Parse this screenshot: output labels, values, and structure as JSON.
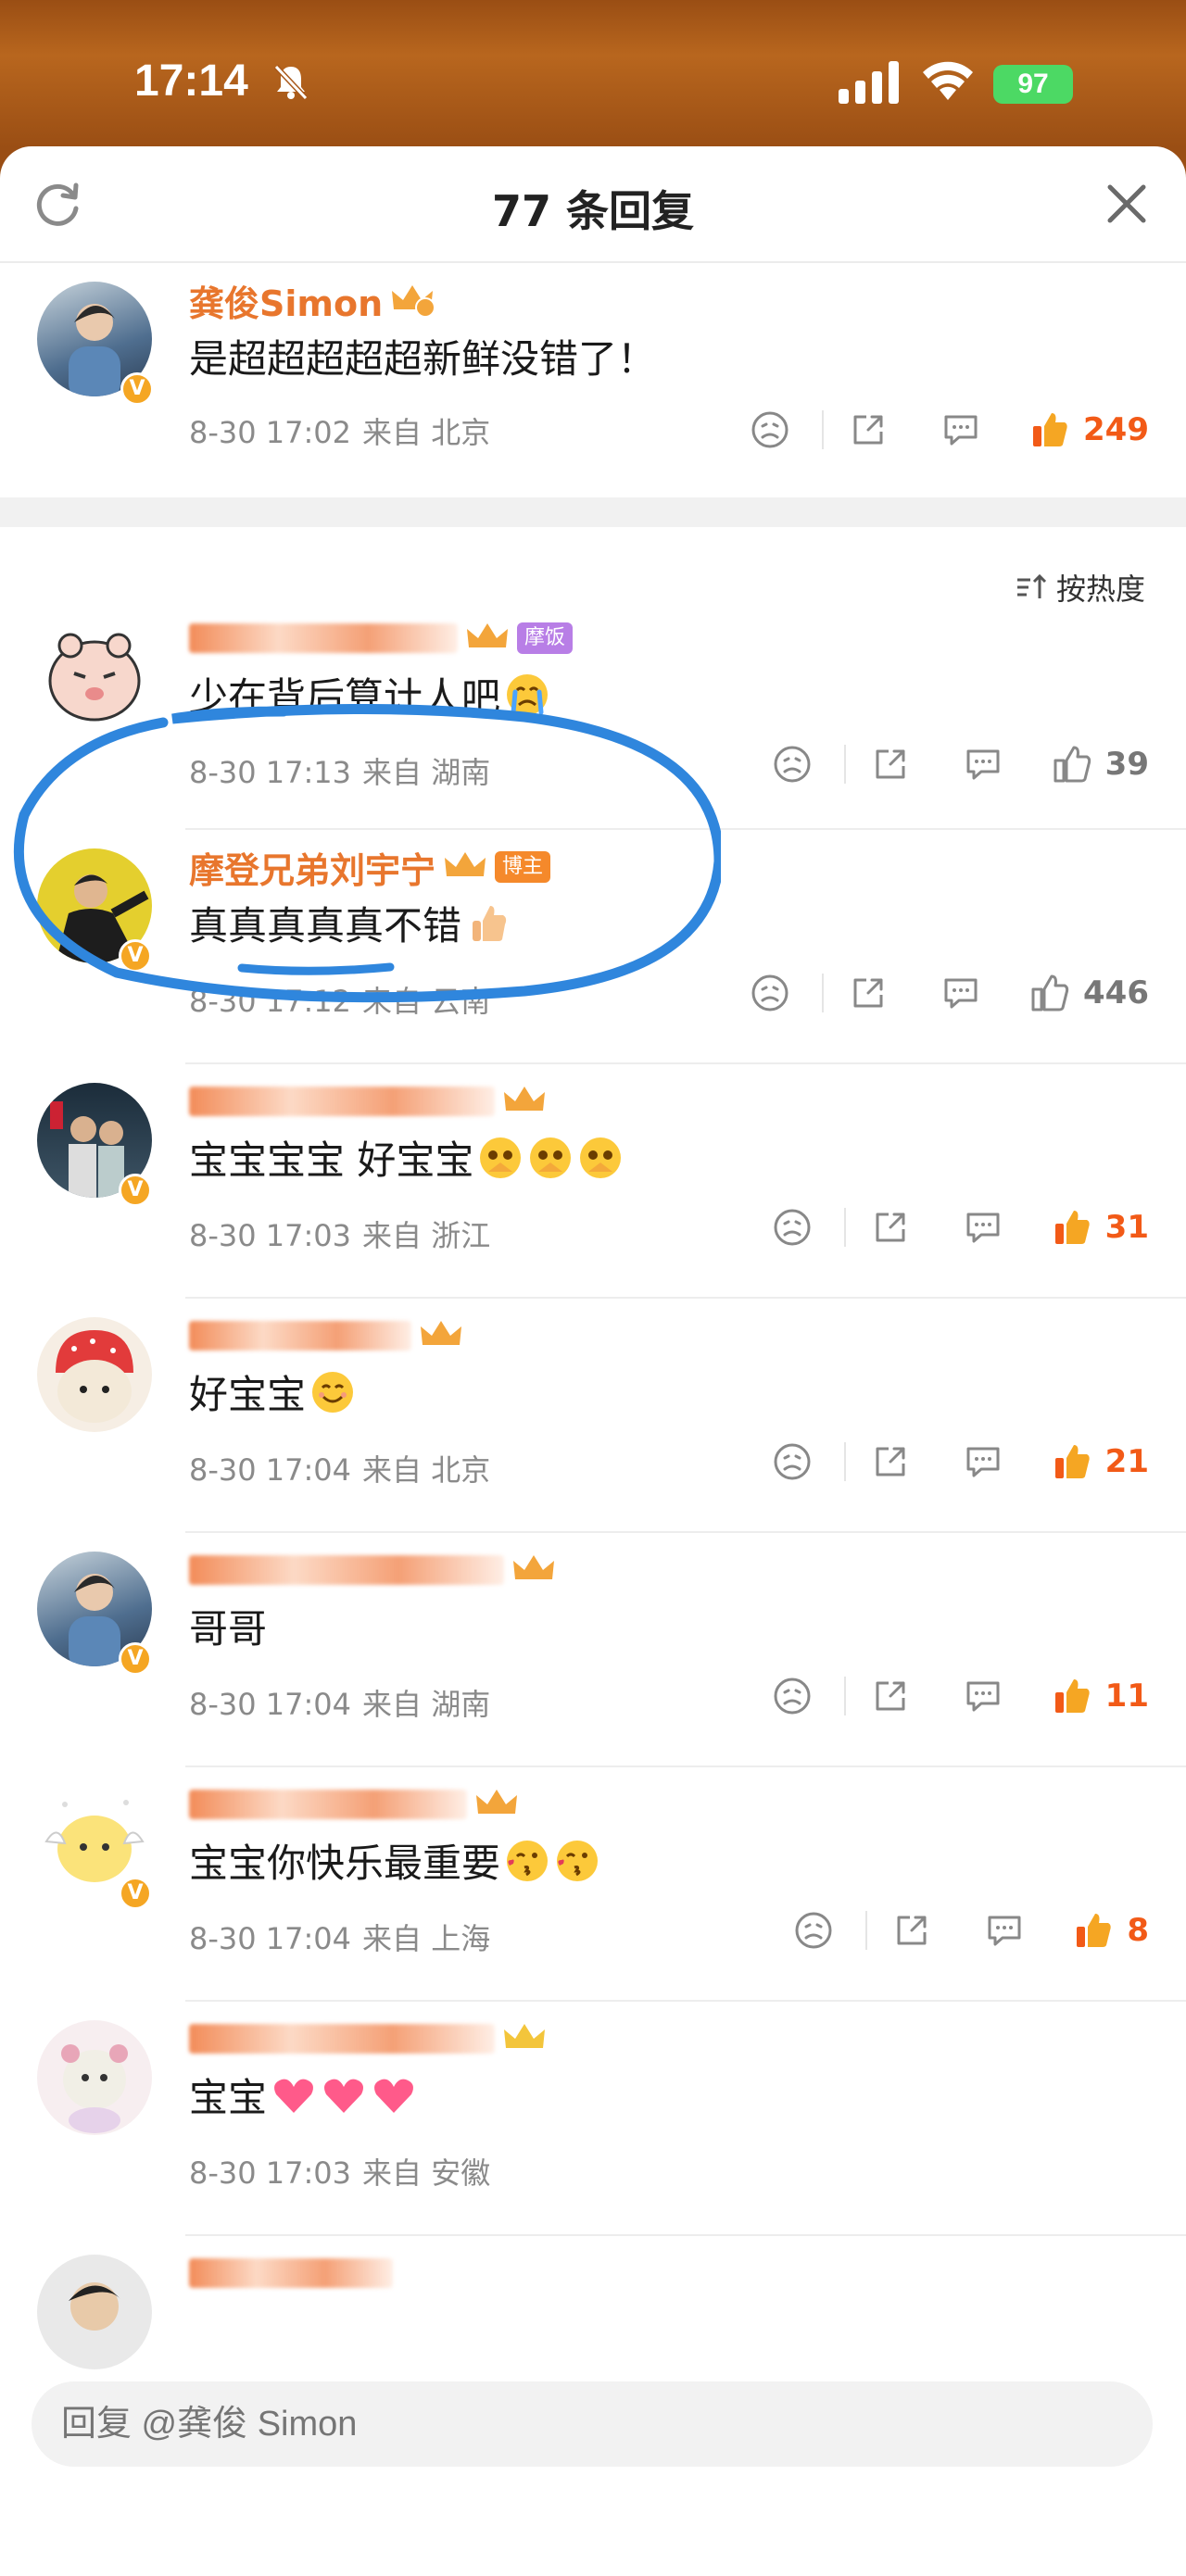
{
  "status_bar": {
    "time": "17:14",
    "battery": "97"
  },
  "header": {
    "title": "77 条回复"
  },
  "root": {
    "username": "龚俊Simon",
    "content": "是超超超超超新鲜没错了！",
    "date": "8-30 17:02",
    "location": "来自 北京",
    "likes": "249",
    "liked": true
  },
  "sort": {
    "label": "按热度"
  },
  "replies": [
    {
      "username": "",
      "tag": "摩饭",
      "content": "少在背后算计人吧",
      "emoji": "crying-face",
      "date": "8-30 17:13",
      "location": "来自 湖南",
      "likes": "39",
      "liked": false
    },
    {
      "username": "摩登兄弟刘宇宁",
      "tag": "博主",
      "content": "真真真真真不错",
      "emoji": "thumbs-up",
      "date": "8-30 17:12",
      "location": "来自 云南",
      "likes": "446",
      "liked": false
    },
    {
      "username": "",
      "content": "宝宝宝宝 好宝宝",
      "emoji": "pleading-face x3",
      "date": "8-30 17:03",
      "location": "来自 浙江",
      "likes": "31",
      "liked": true
    },
    {
      "username": "",
      "content": "好宝宝",
      "emoji": "smiling-face",
      "date": "8-30 17:04",
      "location": "来自 北京",
      "likes": "21",
      "liked": true
    },
    {
      "username": "",
      "content": "哥哥",
      "emoji": "",
      "date": "8-30 17:04",
      "location": "来自 湖南",
      "likes": "11",
      "liked": true
    },
    {
      "username": "",
      "content": "宝宝你快乐最重要",
      "emoji": "kissing-face x2",
      "date": "8-30 17:04",
      "location": "来自 上海",
      "likes": "8",
      "liked": true
    },
    {
      "username": "",
      "content": "宝宝",
      "emoji": "heart x3",
      "date": "8-30 17:03",
      "location": "来自 安徽",
      "likes": "",
      "liked": false
    }
  ],
  "reply_input": {
    "placeholder": "回复 @龚俊 Simon"
  },
  "colors": {
    "accent": "#f25a17",
    "username": "#e8762d",
    "annotation": "#2f86dd"
  }
}
